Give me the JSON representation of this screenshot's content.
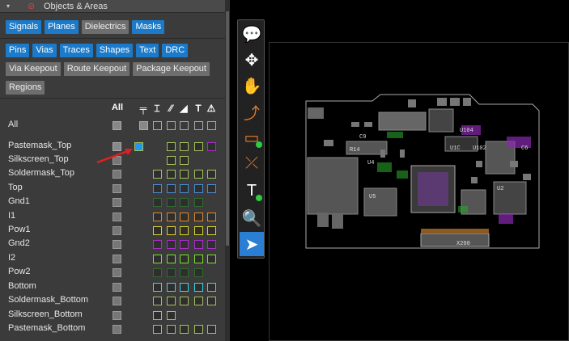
{
  "panel": {
    "title": "Objects & Areas",
    "row1_buttons": [
      {
        "label": "Signals",
        "active": true
      },
      {
        "label": "Planes",
        "active": true
      },
      {
        "label": "Dielectrics",
        "active": false
      },
      {
        "label": "Masks",
        "active": true
      }
    ],
    "row2_buttons": [
      {
        "label": "Pins",
        "active": true
      },
      {
        "label": "Vias",
        "active": true
      },
      {
        "label": "Traces",
        "active": true
      },
      {
        "label": "Shapes",
        "active": true
      },
      {
        "label": "Text",
        "active": true
      },
      {
        "label": "DRC",
        "active": true
      }
    ],
    "row3_buttons": [
      {
        "label": "Via Keepout"
      },
      {
        "label": "Route Keepout"
      },
      {
        "label": "Package Keepout"
      }
    ],
    "row4_buttons": [
      {
        "label": "Regions"
      }
    ],
    "all_column_label": "All",
    "column_icons": [
      "pin-icon",
      "via-icon",
      "trace-icon",
      "shape-icon",
      "text-icon",
      "drc-icon"
    ],
    "column_glyphs": [
      "╤",
      "⌶",
      "⁄⁄",
      "◢",
      "T",
      "⚠"
    ],
    "layers": [
      {
        "name": "All",
        "color": "#bbbbbb"
      },
      {
        "name": "Pastemask_Top",
        "color": "#a4c25a"
      },
      {
        "name": "Silkscreen_Top",
        "color": "#a4c25a"
      },
      {
        "name": "Soldermask_Top",
        "color": "#a4c25a"
      },
      {
        "name": "Top",
        "color": "#4a8fd8"
      },
      {
        "name": "Gnd1",
        "color": "#2e6b2e"
      },
      {
        "name": "I1",
        "color": "#e08a2a"
      },
      {
        "name": "Pow1",
        "color": "#e0d02a"
      },
      {
        "name": "Gnd2",
        "color": "#b02ad0"
      },
      {
        "name": "I2",
        "color": "#7ee02a"
      },
      {
        "name": "Pow2",
        "color": "#2e6b2e"
      },
      {
        "name": "Bottom",
        "color": "#3ad8e0"
      },
      {
        "name": "Soldermask_Bottom",
        "color": "#a4c25a"
      },
      {
        "name": "Silkscreen_Bottom",
        "color": "#a4c25a"
      },
      {
        "name": "Pastemask_Bottom",
        "color": "#a4c25a"
      }
    ]
  },
  "pcb": {
    "labels": [
      "U4",
      "C9",
      "R14",
      "U5",
      "U104",
      "U1C",
      "U102",
      "U2",
      "C6",
      "X200"
    ]
  },
  "toolbar": {
    "tools": [
      "comment-tool",
      "move-tool",
      "pan-tool",
      "route-tool",
      "add-component-tool",
      "edit-trace-tool",
      "add-text-tool",
      "zoom-tool",
      "select-tool"
    ]
  }
}
